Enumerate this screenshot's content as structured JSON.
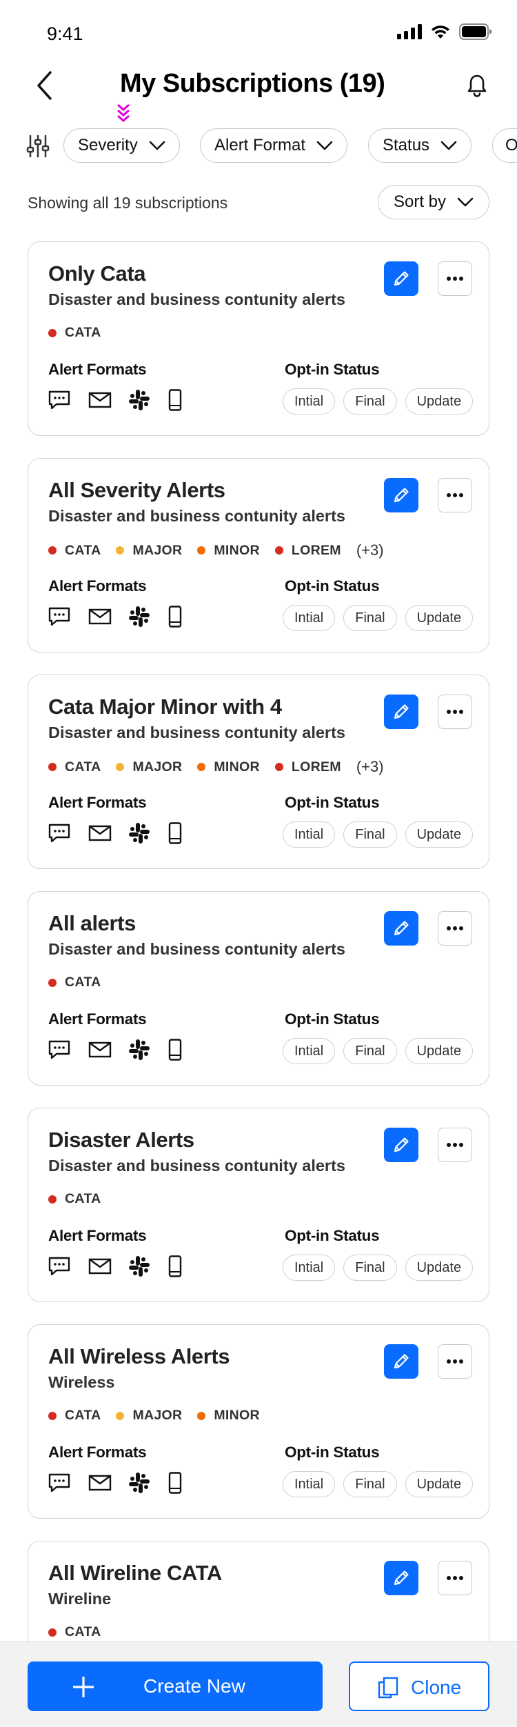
{
  "status_bar": {
    "time": "9:41"
  },
  "header": {
    "title": "My Subscriptions (19)"
  },
  "filters": [
    {
      "label": "Severity"
    },
    {
      "label": "Alert Format"
    },
    {
      "label": "Status"
    },
    {
      "label": "O"
    }
  ],
  "summary": {
    "text": "Showing all 19 subscriptions",
    "sort_label": "Sort by"
  },
  "labels": {
    "alert_formats": "Alert Formats",
    "optin_status": "Opt-in Status"
  },
  "optin_values": [
    "Intial",
    "Final",
    "Update"
  ],
  "format_icons": [
    "chat-icon",
    "mail-icon",
    "slack-icon",
    "phone-icon"
  ],
  "severity_colors": {
    "CATA": "#d52b1e",
    "MAJOR": "#f5b335",
    "MINOR": "#ef6c00",
    "LOREM": "#d52b1e"
  },
  "cards": [
    {
      "title": "Only Cata",
      "subtitle": "Disaster and business contunity alerts",
      "severities": [
        "CATA"
      ],
      "more": ""
    },
    {
      "title": "All Severity Alerts",
      "subtitle": "Disaster and business contunity alerts",
      "severities": [
        "CATA",
        "MAJOR",
        "MINOR",
        "LOREM"
      ],
      "more": "(+3)"
    },
    {
      "title": "Cata Major Minor with 4",
      "subtitle": "Disaster and business contunity alerts",
      "severities": [
        "CATA",
        "MAJOR",
        "MINOR",
        "LOREM"
      ],
      "more": "(+3)"
    },
    {
      "title": "All alerts",
      "subtitle": "Disaster and business contunity alerts",
      "severities": [
        "CATA"
      ],
      "more": ""
    },
    {
      "title": "Disaster Alerts",
      "subtitle": "Disaster and business contunity alerts",
      "severities": [
        "CATA"
      ],
      "more": ""
    },
    {
      "title": "All Wireless Alerts",
      "subtitle": "Wireless",
      "severities": [
        "CATA",
        "MAJOR",
        "MINOR"
      ],
      "more": ""
    },
    {
      "title": "All Wireline CATA",
      "subtitle": "Wireline",
      "severities": [
        "CATA"
      ],
      "more": ""
    }
  ],
  "actions": {
    "create_label": "Create New",
    "clone_label": "Clone"
  }
}
